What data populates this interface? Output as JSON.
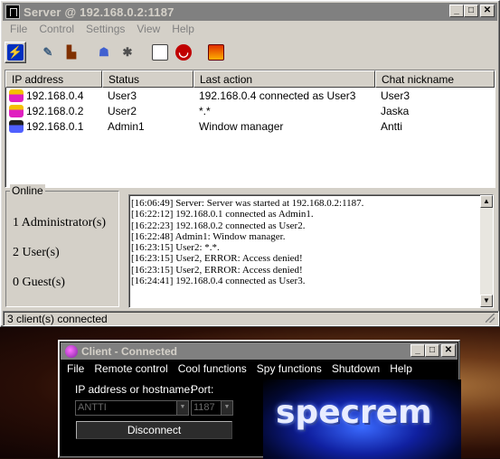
{
  "server": {
    "title": "Server @ 192.168.0.2:1187",
    "menu": [
      "File",
      "Control",
      "Settings",
      "View",
      "Help"
    ],
    "toolbar_icons": [
      "connect-icon",
      "tools-icon",
      "boot-icon",
      "users-icon",
      "wand-icon",
      "window-icon",
      "mouth-icon",
      "screen-icon"
    ],
    "columns": [
      "IP address",
      "Status",
      "Last action",
      "Chat nickname"
    ],
    "clients": [
      {
        "ip": "192.168.0.4",
        "status": "User3",
        "last_action": "192.168.0.4 connected as User3",
        "nickname": "User3",
        "icon": "user-icon"
      },
      {
        "ip": "192.168.0.2",
        "status": "User2",
        "last_action": "*.*",
        "nickname": "Jaska",
        "icon": "user-icon"
      },
      {
        "ip": "192.168.0.1",
        "status": "Admin1",
        "last_action": "Window manager",
        "nickname": "Antti",
        "icon": "admin-icon"
      }
    ],
    "online": {
      "legend": "Online",
      "counts": [
        "1  Administrator(s)",
        "2  User(s)",
        "0  Guest(s)"
      ]
    },
    "log": [
      "[16:06:49] Server: Server was started at 192.168.0.2:1187.",
      "[16:22:12] 192.168.0.1 connected as Admin1.",
      "[16:22:23] 192.168.0.2 connected as User2.",
      "[16:22:48] Admin1: Window manager.",
      "[16:23:15] User2: *.*.",
      "[16:23:15] User2, ERROR: Access denied!",
      "[16:23:15] User2, ERROR: Access denied!",
      "[16:24:41] 192.168.0.4 connected as User3."
    ],
    "status": "3 client(s) connected"
  },
  "client": {
    "title": "Client - Connected",
    "menu": [
      "File",
      "Remote control",
      "Cool functions",
      "Spy functions",
      "Shutdown",
      "Help"
    ],
    "host_label": "IP address or hostname:",
    "port_label": "Port:",
    "host_value": "ANTTI",
    "port_value": "1187",
    "disconnect_label": "Disconnect",
    "logo_text": "specrem"
  },
  "colors": {
    "inactive_title": "#808080",
    "face": "#d4d0c8",
    "client_bg": "#000000"
  }
}
